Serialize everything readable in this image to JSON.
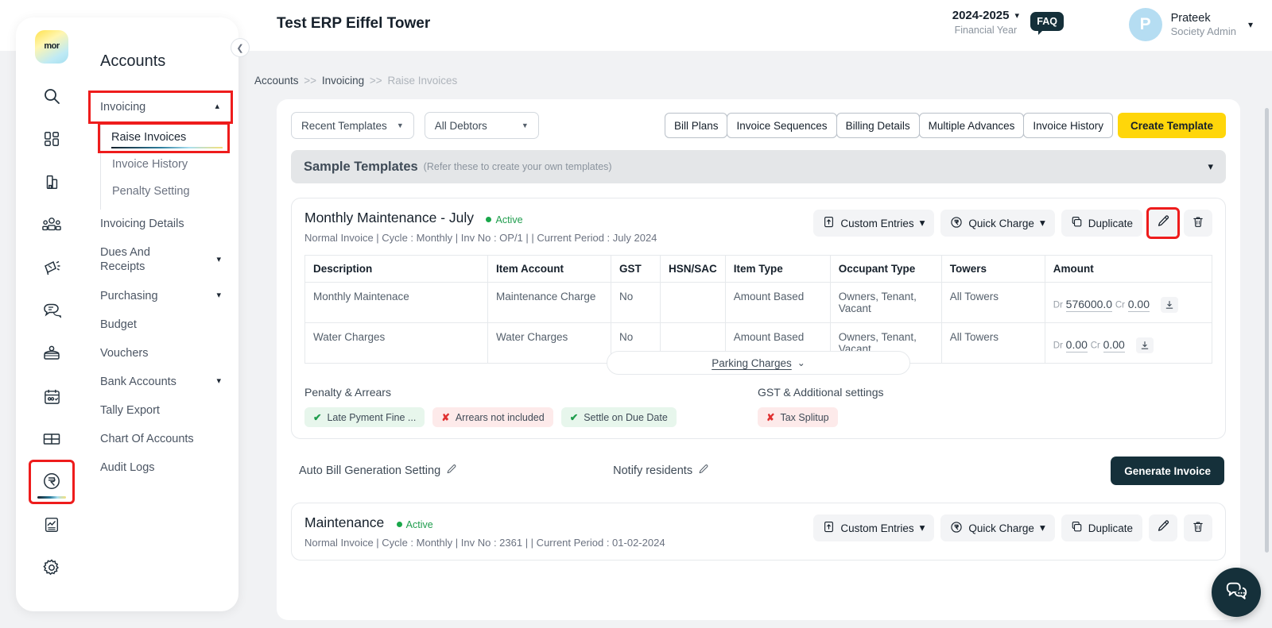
{
  "brand": {
    "logo_text": "mor"
  },
  "topbar": {
    "title": "Test ERP Eiffel Tower",
    "financial_year": "2024-2025",
    "financial_year_label": "Financial Year",
    "faq_label": "FAQ",
    "user_initial": "P",
    "user_name": "Prateek",
    "user_role": "Society Admin"
  },
  "sidebar": {
    "title": "Accounts",
    "collapse_icon": "chevron-left-icon",
    "rail_icons": [
      "search-icon",
      "dashboard-icon",
      "building-icon",
      "people-icon",
      "announcement-icon",
      "chat-dues-icon",
      "purchasing-icon",
      "budget-calendar-icon",
      "vouchers-icon",
      "rupee-circle-icon",
      "tally-export-icon",
      "settings-gear-icon"
    ],
    "items": [
      {
        "label": "Invoicing",
        "expandable": true,
        "expanded": true,
        "highlighted": true
      },
      {
        "label": "Invoicing Details",
        "expandable": false
      },
      {
        "label": "Dues And Receipts",
        "expandable": true
      },
      {
        "label": "Purchasing",
        "expandable": true
      },
      {
        "label": "Budget",
        "expandable": false
      },
      {
        "label": "Vouchers",
        "expandable": false
      },
      {
        "label": "Bank Accounts",
        "expandable": true
      },
      {
        "label": "Tally Export",
        "expandable": false
      },
      {
        "label": "Chart Of Accounts",
        "expandable": false
      },
      {
        "label": "Audit Logs",
        "expandable": false
      }
    ],
    "subitems": [
      {
        "label": "Raise Invoices",
        "active": true,
        "highlighted": true
      },
      {
        "label": "Invoice History",
        "active": false
      },
      {
        "label": "Penalty Setting",
        "active": false
      }
    ]
  },
  "breadcrumb": {
    "root": "Accounts",
    "mid": "Invoicing",
    "current": "Raise Invoices",
    "separator": ">>"
  },
  "toolbar": {
    "filters": [
      {
        "label": "Recent Templates"
      },
      {
        "label": "All Debtors"
      }
    ],
    "buttons": [
      "Bill Plans",
      "Invoice Sequences",
      "Billing Details",
      "Multiple Advances",
      "Invoice History"
    ],
    "primary_label": "Create Template"
  },
  "sample_templates": {
    "title": "Sample Templates",
    "subtitle": "(Refer these to create your own templates)"
  },
  "invoice_card": {
    "name": "Monthly Maintenance - July",
    "status": "Active",
    "meta": "Normal Invoice | Cycle : Monthly | Inv No : OP/1 | | Current Period : July 2024",
    "actions": [
      {
        "label": "Custom Entries",
        "icon": "file-upload-icon",
        "caret": "▾"
      },
      {
        "label": "Quick Charge",
        "icon": "rupee-circle-icon",
        "caret": "▾"
      },
      {
        "label": "Duplicate",
        "icon": "copy-icon",
        "caret": ""
      }
    ],
    "edit_icon": "pencil-icon",
    "delete_icon": "trash-icon",
    "table": {
      "columns": [
        "Description",
        "Item Account",
        "GST",
        "HSN/SAC",
        "Item Type",
        "Occupant Type",
        "Towers",
        "Amount"
      ],
      "rows": [
        {
          "description": "Monthly Maintenace",
          "item_account": "Maintenance Charge",
          "gst": "No",
          "hsn_sac": "",
          "item_type": "Amount Based",
          "occupant_type": "Owners, Tenant, Vacant",
          "towers": "All Towers",
          "dr_label": "Dr",
          "dr_value": "576000.0",
          "cr_label": "Cr",
          "cr_value": "0.00",
          "download_icon": "download-icon"
        },
        {
          "description": "Water Charges",
          "item_account": "Water Charges",
          "gst": "No",
          "hsn_sac": "",
          "item_type": "Amount Based",
          "occupant_type": "Owners, Tenant, Vacant",
          "towers": "All Towers",
          "dr_label": "Dr",
          "dr_value": "0.00",
          "cr_label": "Cr",
          "cr_value": "0.00",
          "download_icon": "download-icon"
        }
      ]
    },
    "parking_pill": {
      "label": "Parking Charges",
      "chevron": "»"
    },
    "penalty_section": {
      "heading": "Penalty & Arrears",
      "chips": [
        {
          "label": "Late Pyment Fine ...",
          "state": "ok"
        },
        {
          "label": "Arrears not included",
          "state": "no"
        },
        {
          "label": "Settle on Due Date",
          "state": "ok"
        }
      ]
    },
    "gst_section": {
      "heading": "GST & Additional settings",
      "chips": [
        {
          "label": "Tax Splitup",
          "state": "no"
        }
      ]
    },
    "footer": {
      "auto_bill": "Auto Bill Generation Setting",
      "notify": "Notify residents",
      "generate_label": "Generate Invoice",
      "edit_icon": "pencil-icon"
    }
  },
  "invoice_card_2": {
    "name": "Maintenance",
    "status": "Active",
    "meta": "Normal Invoice | Cycle : Monthly | Inv No : 2361 | | Current Period : 01-02-2024",
    "actions": [
      {
        "label": "Custom Entries",
        "icon": "file-upload-icon",
        "caret": "▾"
      },
      {
        "label": "Quick Charge",
        "icon": "rupee-circle-icon",
        "caret": "▾"
      },
      {
        "label": "Duplicate",
        "icon": "copy-icon",
        "caret": ""
      }
    ],
    "edit_icon": "pencil-icon",
    "delete_icon": "trash-icon"
  },
  "chat_widget": {
    "icon": "chat-bubbles-icon"
  },
  "colors": {
    "accent_yellow": "#ffd60a",
    "dark": "#15303a",
    "highlight_red": "#ee1c1c",
    "active_green": "#19a74a",
    "danger_red": "#e03131"
  }
}
